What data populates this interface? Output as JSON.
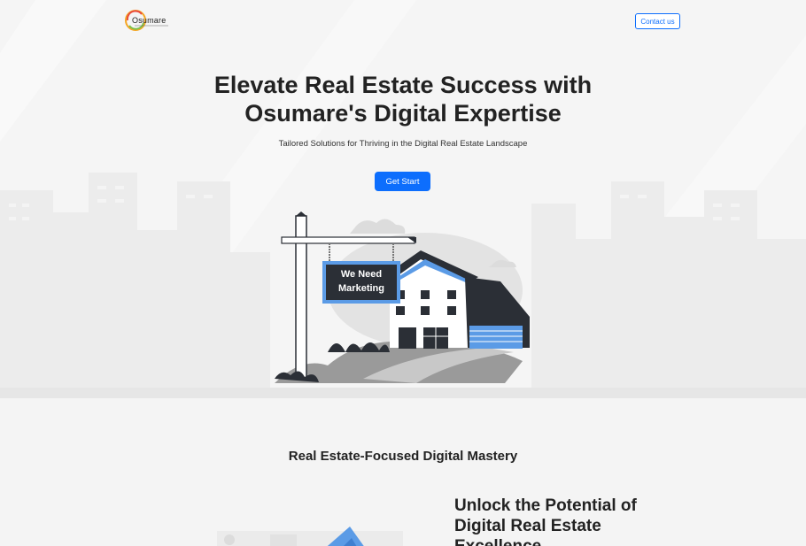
{
  "nav": {
    "logo_text": "Osumare",
    "contact_label": "Contact us"
  },
  "hero": {
    "title": "Elevate Real Estate Success with Osumare's Digital Expertise",
    "subtitle": "Tailored Solutions for Thriving in the Digital Real Estate Landscape",
    "cta_label": "Get Start",
    "sign_line1": "We Need",
    "sign_line2": "Marketing"
  },
  "section": {
    "title": "Real Estate-Focused Digital Mastery",
    "feature_title": "Unlock the Potential of Digital Real Estate Excellence"
  },
  "colors": {
    "primary": "#0d6efd",
    "sign_blue": "#5b9be6",
    "dark": "#2b2f36"
  },
  "icons": [
    "logo-swirl-icon",
    "house-illustration-icon",
    "sign-post-icon"
  ]
}
